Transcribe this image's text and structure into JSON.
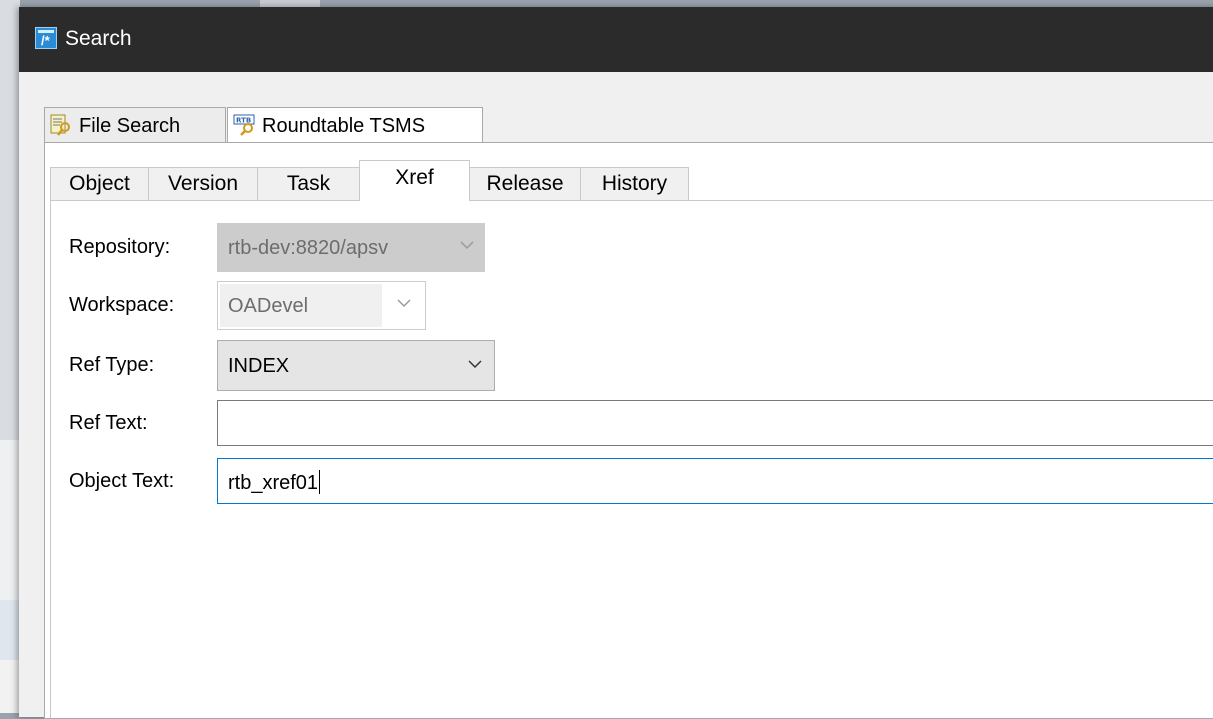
{
  "window": {
    "title": "Search",
    "icon": "search-dialog-icon"
  },
  "outer_tabs": [
    {
      "label": "File Search",
      "icon": "file-search-icon",
      "active": false
    },
    {
      "label": "Roundtable TSMS",
      "icon": "rtb-icon",
      "active": true
    }
  ],
  "inner_tabs": [
    {
      "label": "Object",
      "active": false
    },
    {
      "label": "Version",
      "active": false
    },
    {
      "label": "Task",
      "active": false
    },
    {
      "label": "Xref",
      "active": true
    },
    {
      "label": "Release",
      "active": false
    },
    {
      "label": "History",
      "active": false
    }
  ],
  "form": {
    "repository": {
      "label": "Repository:",
      "value": "rtb-dev:8820/apsv",
      "enabled": false
    },
    "workspace": {
      "label": "Workspace:",
      "value": "OADevel",
      "enabled": false
    },
    "ref_type": {
      "label": "Ref Type:",
      "value": "INDEX",
      "enabled": true
    },
    "ref_text": {
      "label": "Ref Text:",
      "value": ""
    },
    "object_text": {
      "label": "Object Text:",
      "value": "rtb_xref01",
      "focused": true
    }
  },
  "colors": {
    "titlebar": "#2b2b2b",
    "focus_border": "#0078d7",
    "disabled_combo": "#cccccc"
  }
}
